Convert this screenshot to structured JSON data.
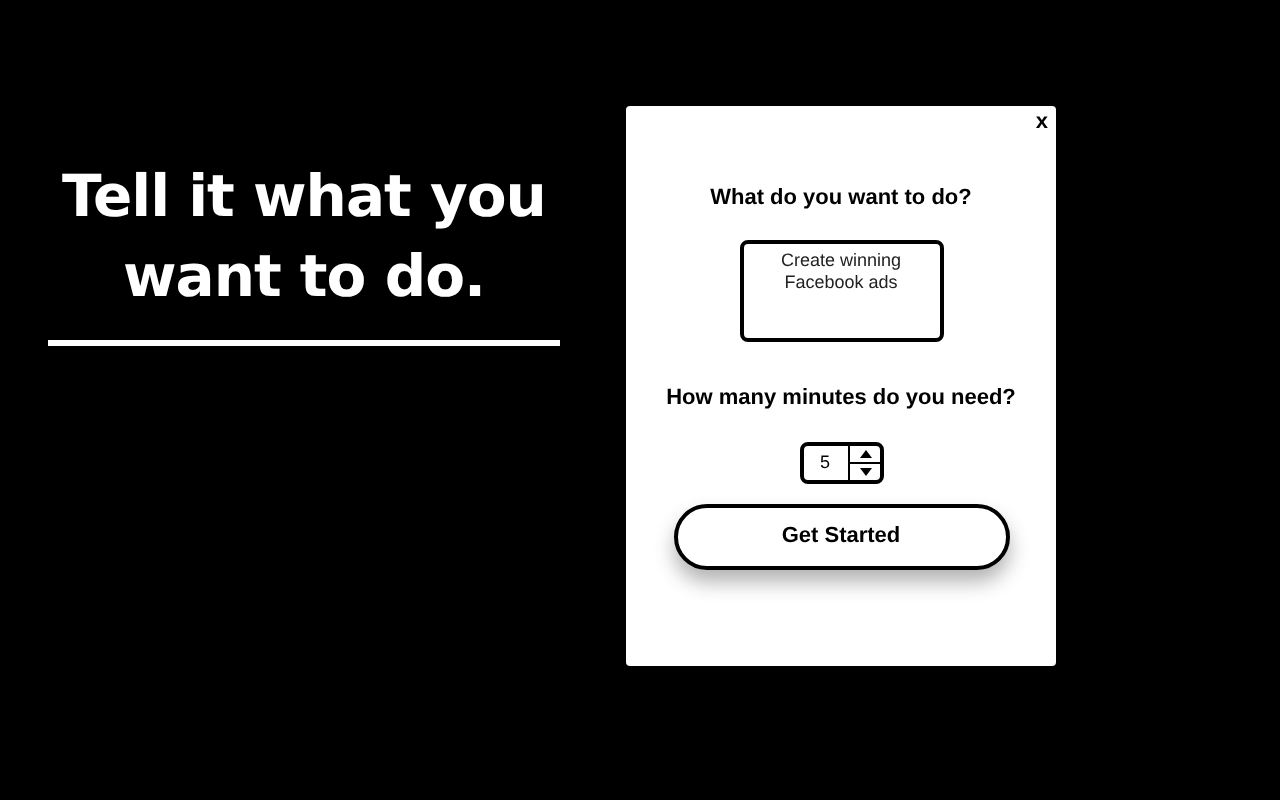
{
  "headline": "Tell it what you want to do.",
  "popup": {
    "close": "x",
    "task_question": "What do you want to do?",
    "task_value": "Create winning Facebook ads",
    "minutes_question": "How many minutes do you need?",
    "minutes_value": "5",
    "button": "Get Started"
  }
}
